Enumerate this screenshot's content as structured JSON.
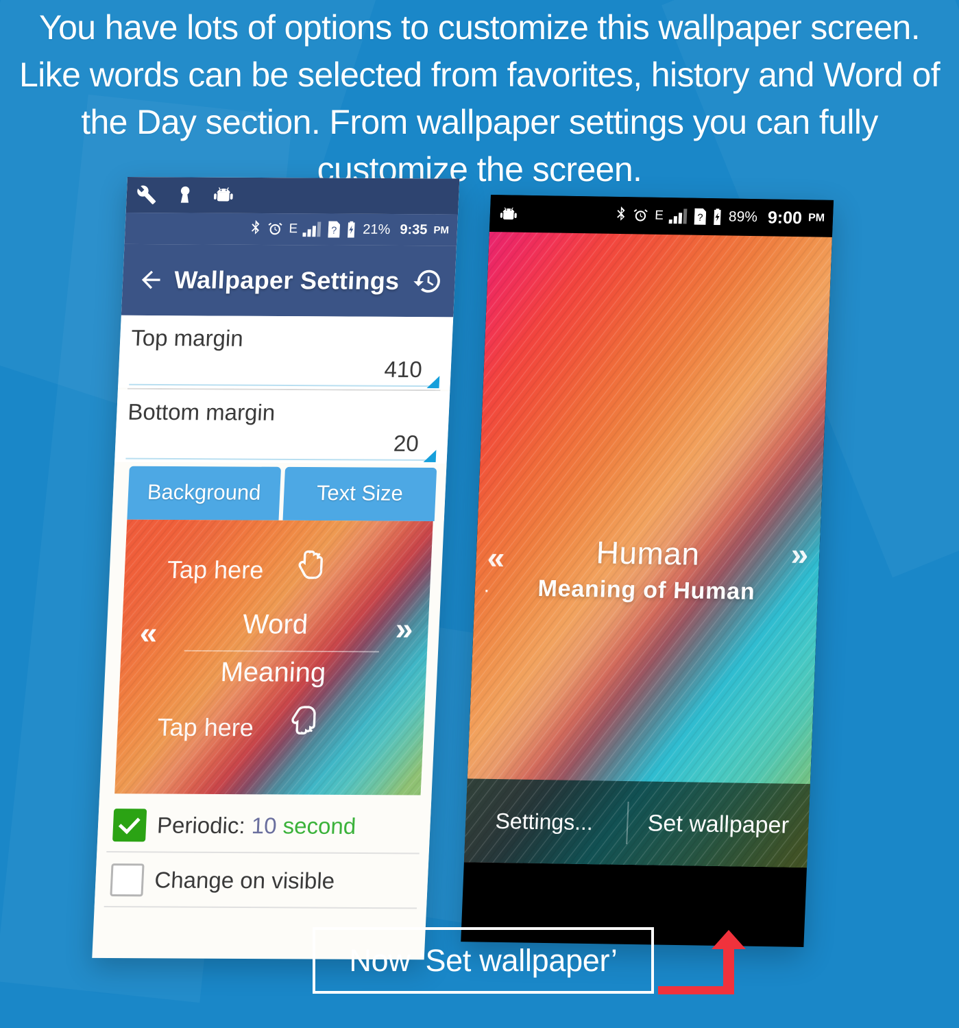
{
  "headline": "You have lots of options to customize this wallpaper screen. Like words can be selected from favorites, history and Word of the Day section. From wallpaper settings you can fully customize the screen.",
  "colors": {
    "background_blue": "#1a87c8",
    "appbar_blue": "#3b5486",
    "notification_blue": "#2e4470",
    "tab_blue": "#4da8e4",
    "slider_accent": "#169fdb",
    "checkbox_green": "#2ba314",
    "unit_green": "#3bb23b",
    "arrow_red": "#f0323c",
    "caption_border": "#ffffff"
  },
  "left_phone": {
    "notification_icons": [
      "wrench-icon",
      "keyhole-icon",
      "android-head-icon"
    ],
    "status_bar": {
      "icons": [
        "bluetooth-icon",
        "alarm-icon",
        "edge-signal-icon",
        "sim-question-icon",
        "battery-charging-icon"
      ],
      "battery_percent": "21%",
      "time": "9:35",
      "meridiem": "PM"
    },
    "appbar": {
      "back_icon": "back-arrow-icon",
      "title": "Wallpaper Settings",
      "history_icon": "history-icon"
    },
    "settings_rows": [
      {
        "label": "Top margin",
        "value": "410"
      },
      {
        "label": "Bottom margin",
        "value": "20"
      }
    ],
    "tabs": [
      {
        "label": "Background"
      },
      {
        "label": "Text Size"
      }
    ],
    "preview": {
      "tap_top": "Tap here",
      "word": "Word",
      "meaning": "Meaning",
      "tap_bottom": "Tap here",
      "prev": "«",
      "next": "»",
      "hand_top_icon": "hand-point-down-icon",
      "hand_bottom_icon": "hand-point-up-icon"
    },
    "checkboxes": [
      {
        "label": "Periodic: ",
        "number": "10",
        "unit": " second",
        "checked": true
      },
      {
        "label": "Change on visible",
        "number": "",
        "unit": "",
        "checked": false
      }
    ]
  },
  "right_phone": {
    "status_bar": {
      "left_icon": "android-head-icon",
      "icons": [
        "bluetooth-icon",
        "alarm-icon",
        "edge-signal-icon",
        "sim-question-icon",
        "battery-charging-icon"
      ],
      "battery_percent": "89%",
      "time": "9:00",
      "meridiem": "PM"
    },
    "wallpaper": {
      "word": "Human",
      "meaning": "Meaning of Human",
      "prev": "«",
      "next": "»",
      "marker": "·"
    },
    "bottom_bar": {
      "settings_label": "Settings...",
      "set_wallpaper_label": "Set wallpaper"
    }
  },
  "caption": {
    "text": "Now ‘Set wallpaper’",
    "arrow_icon": "up-arrow-callout-icon"
  }
}
